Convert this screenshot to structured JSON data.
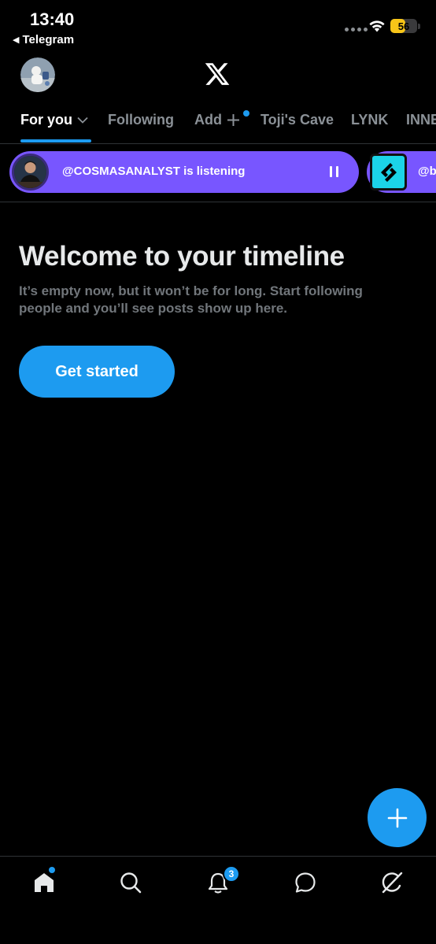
{
  "status_bar": {
    "time": "13:40",
    "back_app": "Telegram",
    "battery_level": "56",
    "battery_color": "#f7c518"
  },
  "header": {
    "logo_icon": "x-logo-icon",
    "avatar_icon": "profile-avatar"
  },
  "tabs": [
    {
      "label": "For you",
      "active": true
    },
    {
      "label": "Following"
    },
    {
      "label": "Add"
    },
    {
      "label": "Toji's Cave"
    },
    {
      "label": "LYNK"
    },
    {
      "label": "INNE"
    }
  ],
  "spaces": [
    {
      "text": "@COSMASANALYST is listening",
      "icon": "pause-icon"
    },
    {
      "text": "@b"
    }
  ],
  "empty_state": {
    "title": "Welcome to your timeline",
    "subtitle": "It’s empty now, but it won’t be for long. Start following people and you’ll see posts show up here.",
    "button": "Get started"
  },
  "fab": {
    "icon": "plus-icon"
  },
  "bottom_nav": {
    "items": [
      "home-icon",
      "search-icon",
      "bell-icon",
      "chat-icon",
      "grok-icon"
    ],
    "notification_badge": "3"
  },
  "colors": {
    "accent": "#1d9bf0",
    "spaces_purple": "#7856ff",
    "background": "#000000"
  }
}
